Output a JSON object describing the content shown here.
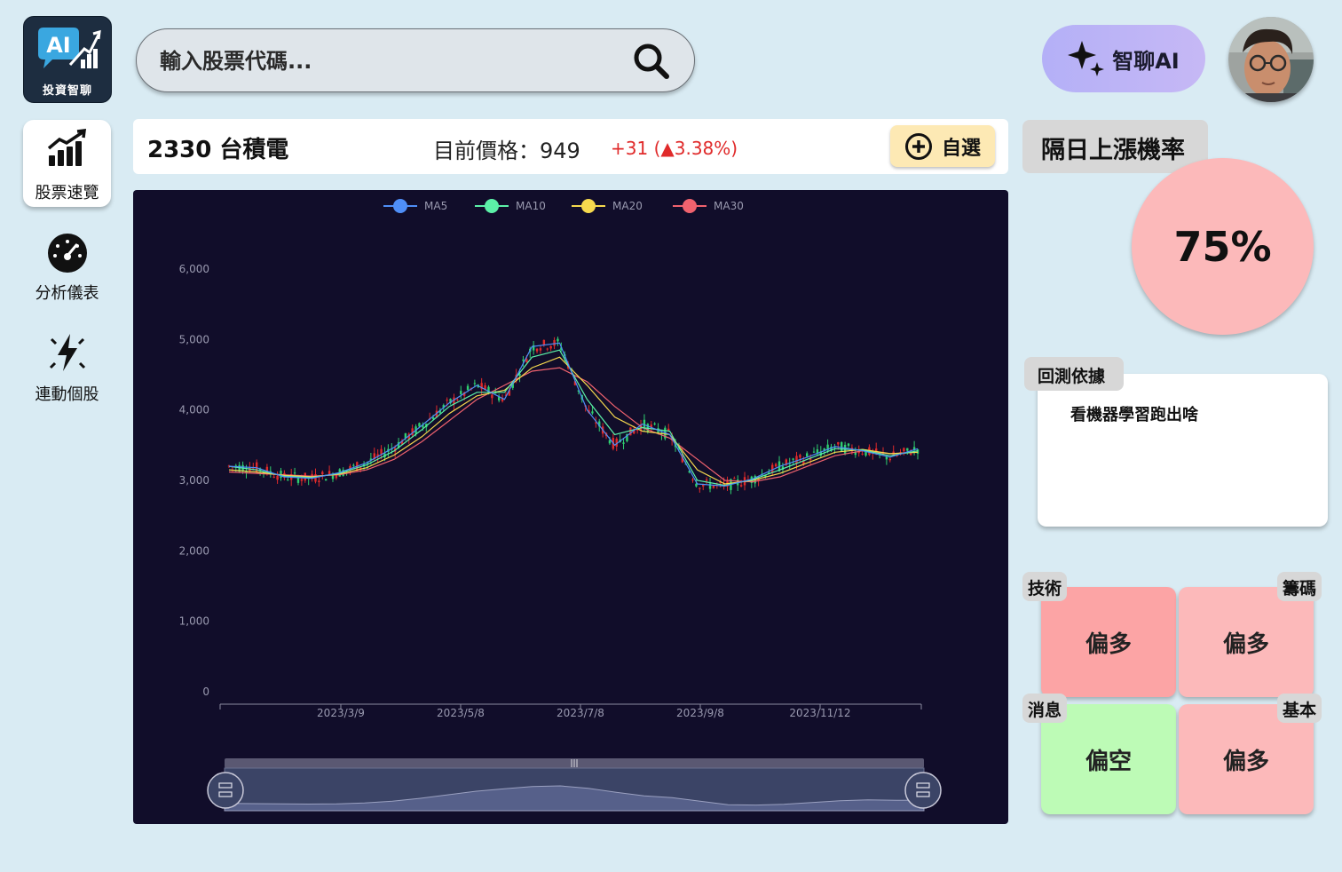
{
  "app": {
    "logo_text": "投資智聊",
    "logo_ai": "AI"
  },
  "search": {
    "placeholder": "輸入股票代碼..."
  },
  "ai_button": {
    "label": "智聊AI"
  },
  "sidebar": {
    "items": [
      {
        "label": "股票速覽",
        "icon": "bar-chart-up-icon",
        "active": true
      },
      {
        "label": "分析儀表",
        "icon": "speedometer-icon",
        "active": false
      },
      {
        "label": "連動個股",
        "icon": "lightning-icon",
        "active": false
      }
    ]
  },
  "stock": {
    "name": "2330 台積電",
    "price_label": "目前價格：949",
    "change": "+31 (▲3.38%)",
    "watch_label": "自選"
  },
  "probability": {
    "title": "隔日上漲機率",
    "value": "75%"
  },
  "backtest": {
    "tab": "回測依據",
    "text": "看機器學習跑出啥"
  },
  "signals": [
    {
      "tag": "技術",
      "value": "偏多",
      "color": "#fca4a5"
    },
    {
      "tag": "籌碼",
      "value": "偏多",
      "color": "#fcb9ba"
    },
    {
      "tag": "消息",
      "value": "偏空",
      "color": "#bdfbb6"
    },
    {
      "tag": "基本",
      "value": "偏多",
      "color": "#fcb9ba"
    }
  ],
  "colors": {
    "up": "#e02a2a",
    "ma5": "#4f8ef7",
    "ma10": "#5cf0a8",
    "ma20": "#f6d94e",
    "ma30": "#f0626e",
    "chart_bg": "#110d2a"
  },
  "chart_data": {
    "type": "line",
    "legend": [
      "MA5",
      "MA10",
      "MA20",
      "MA30"
    ],
    "legend_placement": "top-center",
    "y_ticks": [
      "0",
      "1,000",
      "2,000",
      "3,000",
      "4,000",
      "5,000",
      "6,000"
    ],
    "ylim": [
      0,
      6000
    ],
    "x_ticks": [
      "2023/3/9",
      "2023/5/8",
      "2023/7/8",
      "2023/9/8",
      "2023/11/12"
    ],
    "grid": false,
    "series": [
      {
        "name": "MA30",
        "values": [
          3120,
          3100,
          3080,
          3060,
          3080,
          3150,
          3300,
          3550,
          3850,
          4150,
          4350,
          4550,
          4600,
          4400,
          4050,
          3750,
          3600,
          3300,
          3000,
          2980,
          3050,
          3200,
          3350,
          3420,
          3380,
          3400
        ]
      },
      {
        "name": "MA20",
        "values": [
          3150,
          3120,
          3070,
          3050,
          3090,
          3180,
          3360,
          3620,
          3950,
          4200,
          4280,
          4600,
          4750,
          4350,
          3900,
          3700,
          3650,
          3150,
          2950,
          3000,
          3100,
          3250,
          3400,
          3440,
          3380,
          3400
        ]
      },
      {
        "name": "MA10",
        "values": [
          3200,
          3150,
          3060,
          3040,
          3100,
          3220,
          3420,
          3720,
          4050,
          4250,
          4250,
          4750,
          4850,
          4150,
          3650,
          3750,
          3700,
          3000,
          2930,
          3010,
          3150,
          3300,
          3450,
          3430,
          3350,
          3420
        ]
      },
      {
        "name": "MA5",
        "values": [
          3200,
          3180,
          3050,
          3030,
          3110,
          3250,
          3470,
          3780,
          4100,
          4350,
          4150,
          4900,
          4950,
          4000,
          3500,
          3800,
          3650,
          2950,
          2920,
          3020,
          3200,
          3330,
          3480,
          3420,
          3330,
          3450
        ]
      }
    ]
  }
}
